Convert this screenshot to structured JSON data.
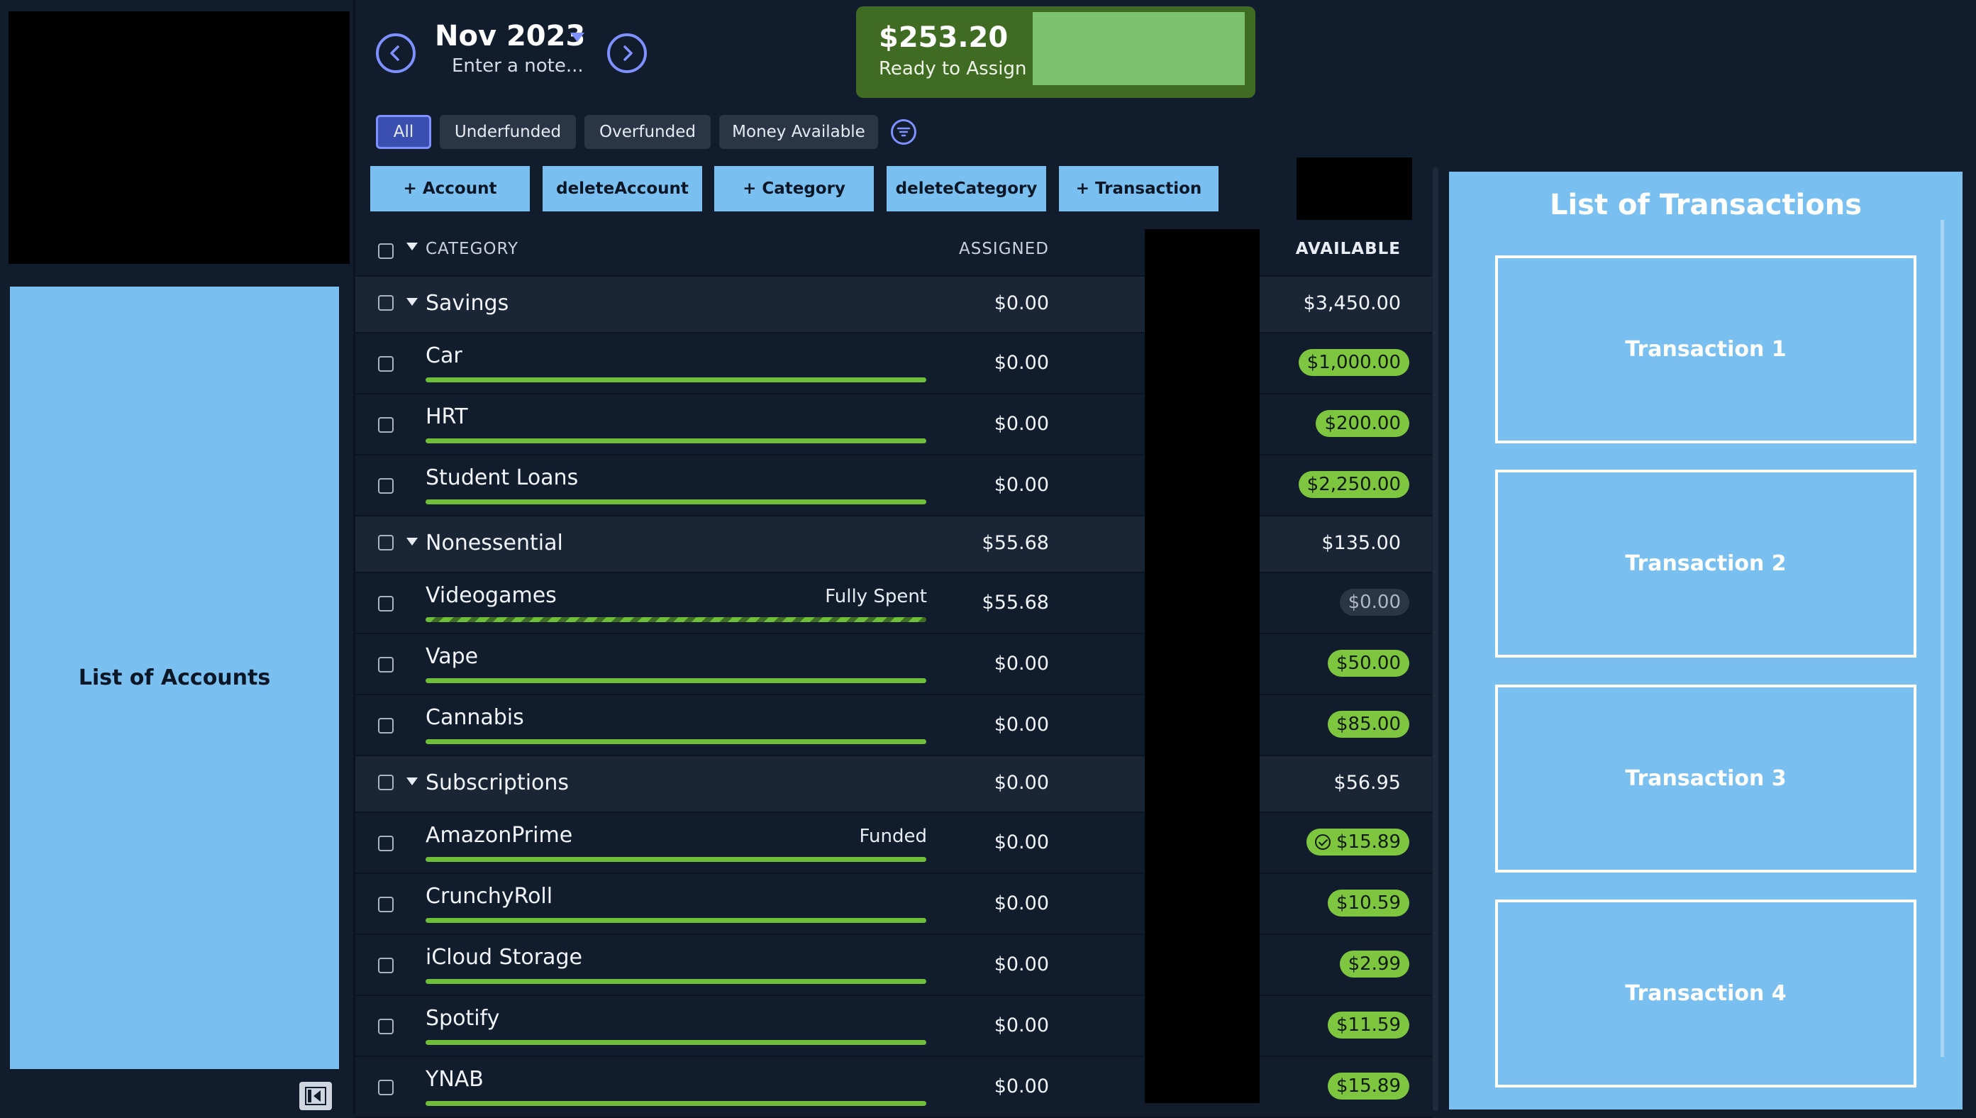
{
  "header": {
    "month": "Nov 2023",
    "note_placeholder": "Enter a note...",
    "ready_to_assign": {
      "amount": "$253.20",
      "label": "Ready to Assign"
    }
  },
  "filters": [
    "All",
    "Underfunded",
    "Overfunded",
    "Money Available"
  ],
  "toolbar": {
    "add_account": "+ Account",
    "delete_account": "deleteAccount",
    "add_category": "+ Category",
    "delete_category": "deleteCategory",
    "add_transaction": "+ Transaction"
  },
  "table": {
    "headers": {
      "category": "CATEGORY",
      "assigned": "ASSIGNED",
      "available": "AVAILABLE"
    },
    "groups": [
      {
        "name": "Savings",
        "assigned": "$0.00",
        "available": "$3,450.00",
        "categories": [
          {
            "name": "Car",
            "assigned": "$0.00",
            "available": "$1,000.00",
            "status": "",
            "pill": "green"
          },
          {
            "name": "HRT",
            "assigned": "$0.00",
            "available": "$200.00",
            "status": "",
            "pill": "green"
          },
          {
            "name": "Student Loans",
            "assigned": "$0.00",
            "available": "$2,250.00",
            "status": "",
            "pill": "green"
          }
        ]
      },
      {
        "name": "Nonessential",
        "assigned": "$55.68",
        "available": "$135.00",
        "categories": [
          {
            "name": "Videogames",
            "assigned": "$55.68",
            "available": "$0.00",
            "status": "Fully Spent",
            "pill": "zero"
          },
          {
            "name": "Vape",
            "assigned": "$0.00",
            "available": "$50.00",
            "status": "",
            "pill": "green"
          },
          {
            "name": "Cannabis",
            "assigned": "$0.00",
            "available": "$85.00",
            "status": "",
            "pill": "green"
          }
        ]
      },
      {
        "name": "Subscriptions",
        "assigned": "$0.00",
        "available": "$56.95",
        "categories": [
          {
            "name": "AmazonPrime",
            "assigned": "$0.00",
            "available": "$15.89",
            "status": "Funded",
            "pill": "check"
          },
          {
            "name": "CrunchyRoll",
            "assigned": "$0.00",
            "available": "$10.59",
            "status": "",
            "pill": "green"
          },
          {
            "name": "iCloud Storage",
            "assigned": "$0.00",
            "available": "$2.99",
            "status": "",
            "pill": "green"
          },
          {
            "name": "Spotify",
            "assigned": "$0.00",
            "available": "$11.59",
            "status": "",
            "pill": "green"
          },
          {
            "name": "YNAB",
            "assigned": "$0.00",
            "available": "$15.89",
            "status": "",
            "pill": "green"
          }
        ]
      }
    ]
  },
  "sidebar": {
    "accounts_label": "List of Accounts"
  },
  "transactions": {
    "title": "List of Transactions",
    "items": [
      "Transaction 1",
      "Transaction 2",
      "Transaction 3",
      "Transaction 4"
    ]
  },
  "colors": {
    "background": "#111c2c",
    "accent": "#7f90ff",
    "panel_blue": "#79c0f0",
    "funded_green": "#7fc640",
    "ready_box": "#3f6b23"
  }
}
